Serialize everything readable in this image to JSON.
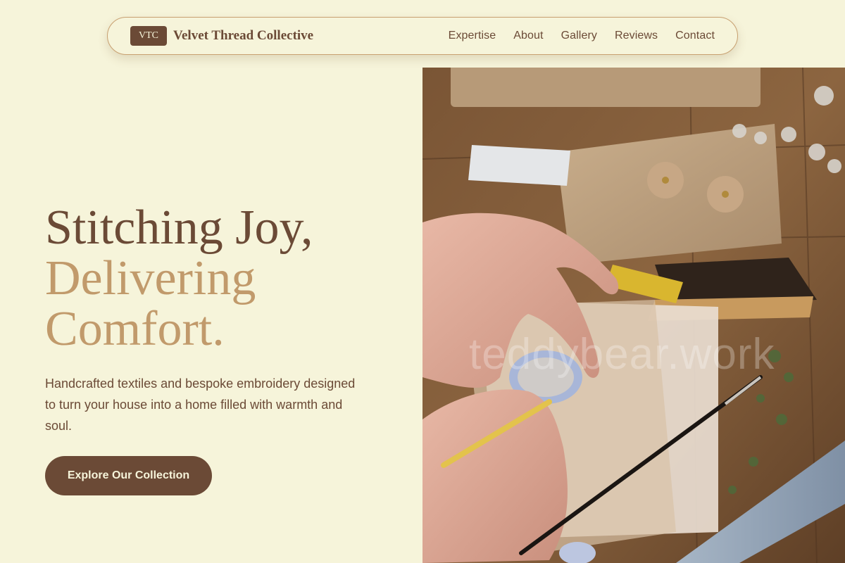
{
  "brand": {
    "badge": "VTC",
    "name": "Velvet Thread Collective"
  },
  "nav": {
    "links": [
      {
        "label": "Expertise"
      },
      {
        "label": "About"
      },
      {
        "label": "Gallery"
      },
      {
        "label": "Reviews"
      },
      {
        "label": "Contact"
      }
    ]
  },
  "hero": {
    "title_line1": "Stitching Joy,",
    "title_line2": "Delivering",
    "title_line3": "Comfort.",
    "description": "Handcrafted textiles and bespoke embroidery designed to turn your house into a home filled with warmth and soul.",
    "cta_label": "Explore Our Collection",
    "image_watermark": "teddybear.work"
  },
  "colors": {
    "background": "#f6f4da",
    "primary": "#6b4a36",
    "accent": "#c19a6b"
  }
}
